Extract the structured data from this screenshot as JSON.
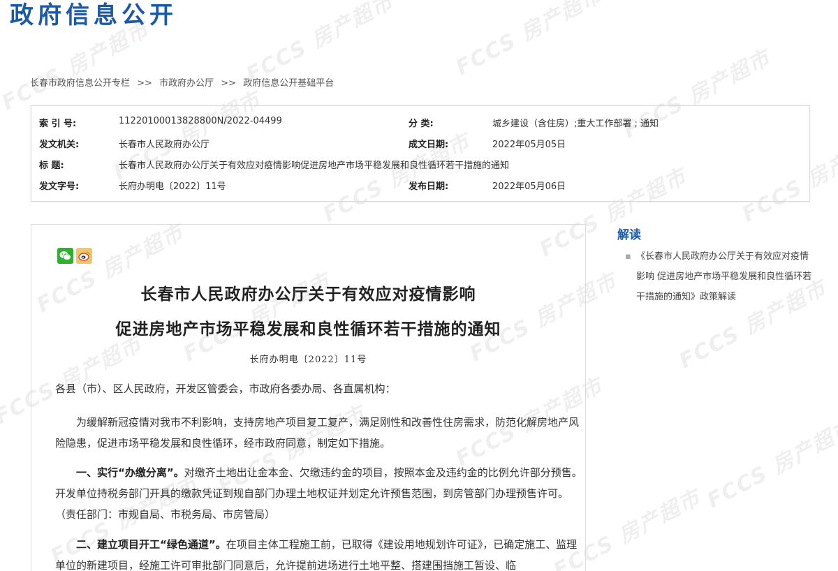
{
  "site": {
    "title": "政府信息公开"
  },
  "breadcrumb": {
    "items": [
      "长春市政府信息公开专栏",
      "市政府办公厅",
      "政府信息公开基础平台"
    ],
    "separator": ">>"
  },
  "meta": {
    "index_label": "索 引 号:",
    "index_value": "11220100013828800N/2022-04499",
    "category_label": "分 类:",
    "category_value": "城乡建设（含住房）;重大工作部署 ; 通知",
    "issuer_label": "发文机关:",
    "issuer_value": "长春市人民政府办公厅",
    "created_label": "成文日期:",
    "created_value": "2022年05月05日",
    "title_label": "标 题:",
    "title_value": "长春市人民政府办公厅关于有效应对疫情影响促进房地产市场平稳发展和良性循环若干措施的通知",
    "docno_label": "发文字号:",
    "docno_value": "长府办明电〔2022〕11号",
    "published_label": "发布日期:",
    "published_value": "2022年05月06日"
  },
  "article": {
    "title_line1": "长春市人民政府办公厅关于有效应对疫情影响",
    "title_line2": "促进房地产市场平稳发展和良性循环若干措施的通知",
    "doc_no": "长府办明电〔2022〕11号",
    "salutation": "各县（市）、区人民政府，开发区管委会，市政府各委办局、各直属机构：",
    "intro": "为缓解新冠疫情对我市不利影响，支持房地产项目复工复产，满足刚性和改善性住房需求，防范化解房地产风险隐患，促进市场平稳发展和良性循环，经市政府同意，制定如下措施。",
    "item1_heading": "一、实行“办缴分离”。",
    "item1_body": "对缴齐土地出让金本金、欠缴违约金的项目，按照本金及违约金的比例允许部分预售。开发单位持税务部门开具的缴款凭证到规自部门办理土地权证并划定允许预售范围，到房管部门办理预售许可。（责任部门：市规自局、市税务局、市房管局）",
    "item2_heading": "二、建立项目开工“绿色通道”。",
    "item2_body": "在项目主体工程施工前，已取得《建设用地规划许可证》，已确定施工、监理单位的新建项目，经施工许可审批部门同意后，允许提前进场进行土地平整、搭建围挡施工暂设、临"
  },
  "share": {
    "wechat_icon": "wechat-icon",
    "weibo_icon": "weibo-icon"
  },
  "sidebar": {
    "title": "解读",
    "items": [
      "《长春市人民政府办公厅关于有效应对疫情影响 促进房地产市场平稳发展和良性循环若干措施的通知》政策解读"
    ]
  },
  "watermark": {
    "text": "FCCS 房产超市"
  },
  "colors": {
    "accent": "#1a5aa8"
  }
}
